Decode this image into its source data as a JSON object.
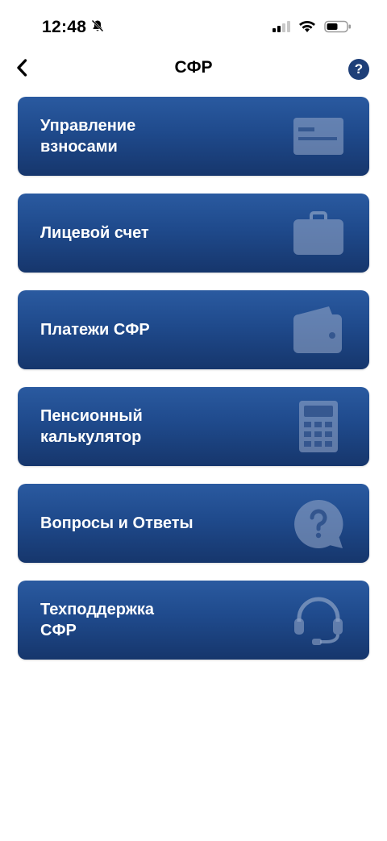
{
  "status_bar": {
    "time": "12:48"
  },
  "header": {
    "title": "СФР",
    "help_label": "?"
  },
  "menu": {
    "items": [
      {
        "label": "Управление\n взносами",
        "icon": "card-icon"
      },
      {
        "label": "Лицевой счет",
        "icon": "briefcase-icon"
      },
      {
        "label": "Платежи СФР",
        "icon": "wallet-icon"
      },
      {
        "label": "Пенсионный\n калькулятор",
        "icon": "calculator-icon"
      },
      {
        "label": "Вопросы и Ответы",
        "icon": "question-bubble-icon"
      },
      {
        "label": "Техподдержка\n СФР",
        "icon": "headset-icon"
      }
    ]
  },
  "colors": {
    "card_top": "#2a5aa0",
    "card_bottom": "#16366c",
    "help_button": "#1e3f78",
    "icon_fill": "#8fa4c6"
  }
}
